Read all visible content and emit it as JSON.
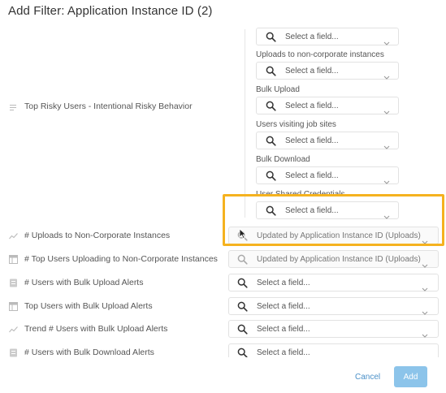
{
  "dialog": {
    "title": "Add Filter: Application Instance ID (2)"
  },
  "group": {
    "label": "Top Risky Users - Intentional Risky Behavior",
    "icon": "lines-icon",
    "fields": [
      {
        "label": "",
        "placeholder": "Select a field..."
      },
      {
        "label": "Uploads to non-corporate instances",
        "placeholder": "Select a field..."
      },
      {
        "label": "Bulk Upload",
        "placeholder": "Select a field..."
      },
      {
        "label": "Users visiting job sites",
        "placeholder": "Select a field..."
      },
      {
        "label": "Bulk Download",
        "placeholder": "Select a field..."
      },
      {
        "label": "User Shared Credentials",
        "placeholder": "Select a field..."
      }
    ]
  },
  "rows": [
    {
      "label": "# Uploads to Non-Corporate Instances",
      "icon": "trend-icon",
      "value": "Updated by Application Instance ID (Uploads)"
    },
    {
      "label": "# Top Users Uploading to Non-Corporate Instances",
      "icon": "table-icon",
      "value": "Updated by Application Instance ID (Uploads)"
    },
    {
      "label": "# Users with Bulk Upload Alerts",
      "icon": "number-icon",
      "value": "Select a field..."
    },
    {
      "label": "Top Users with Bulk Upload Alerts",
      "icon": "table-icon",
      "value": "Select a field..."
    },
    {
      "label": "Trend # Users with Bulk Upload Alerts",
      "icon": "trend-icon",
      "value": "Select a field..."
    },
    {
      "label": "# Users with Bulk Download Alerts",
      "icon": "number-icon",
      "value": "Select a field..."
    }
  ],
  "footer": {
    "cancel_label": "Cancel",
    "add_label": "Add"
  },
  "colors": {
    "highlight": "#f5b21f",
    "add_button": "#8cc4ea",
    "cancel_link": "#4a90c8"
  }
}
